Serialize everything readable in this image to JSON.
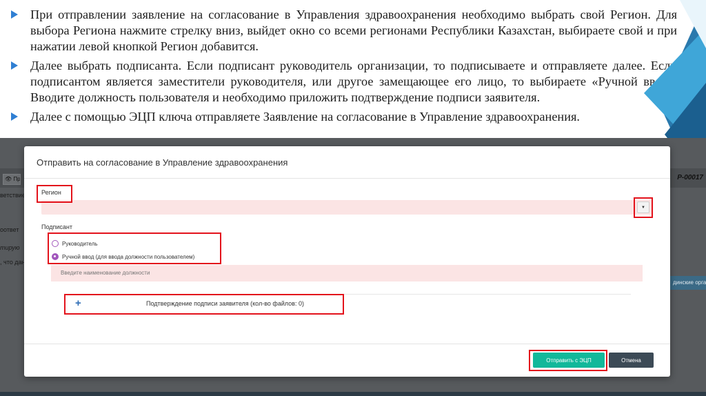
{
  "slide": {
    "bullets": [
      "При отправлении заявление на согласование в Управления здравоохранения необходимо выбрать свой Регион. Для выбора Региона нажмите стрелку вниз, выйдет окно со всеми регионами Республики Казахстан, выбираете свой и при нажатии левой кнопкой Регион добавится.",
      "Далее выбрать подписанта. Если подписант руководитель организации, то подписываете и отправляете далее. Если подписантом является заместители руководителя, или другое замещающее его лицо, то выбираете «Ручной ввод». Вводите должность пользователя и необходимо приложить подтверждение подписи заявителя.",
      "Далее с помощью ЭЦП ключа отправляете Заявление на согласование в Управление здравоохранения."
    ],
    "accent_color": "#2f7fd3"
  },
  "background_app": {
    "tab_label": "👁 Пр",
    "left_fragments": [
      "ветствие",
      "оответ",
      "тирую",
      ", что дан"
    ],
    "doc_code": "Р-00017",
    "side_button": "динские орга"
  },
  "modal": {
    "title": "Отправить на согласование в Управление здравоохранения",
    "region_label": "Регион",
    "region_value": "",
    "region_arrow_icon": "caret-down-icon",
    "signer_label": "Подписант",
    "signer_options": [
      {
        "label": "Руководитель",
        "checked": false
      },
      {
        "label": "Ручной ввод (для ввода должности пользователем)",
        "checked": true
      }
    ],
    "position_placeholder": "Введите наименование должности",
    "confirmation_plus": "+",
    "confirmation_label": "Подтверждение подписи заявителя (кол-во файлов: 0)",
    "send_button": "Отправить с ЭЦП",
    "cancel_button": "Отмена",
    "send_color": "#12b89a",
    "cancel_color": "#3c4a56",
    "highlight_color": "#e3121b"
  }
}
